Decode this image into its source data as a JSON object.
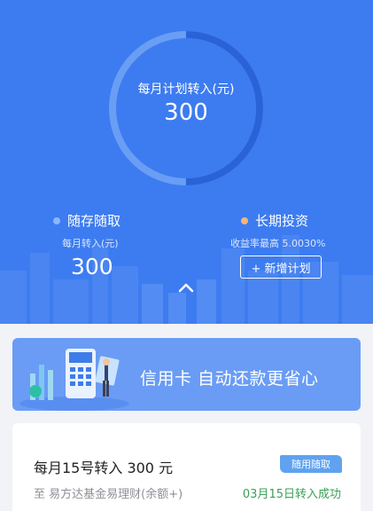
{
  "monthly_plan": {
    "label": "每月计划转入(元)",
    "value": "300",
    "progress": 0.5
  },
  "options": {
    "flexible": {
      "label": "随存随取",
      "sub_label": "每月转入(元)",
      "value": "300",
      "dot_color": "#8ab6ff"
    },
    "long_term": {
      "label": "长期投资",
      "sub_label": "收益率最高 5.0030%",
      "button_label": "+ 新增计划",
      "dot_color": "#f3b77a"
    }
  },
  "banner": {
    "text": "信用卡  自动还款更省心"
  },
  "plan": {
    "title": "每月15号转入 300 元",
    "badge": "随用随取",
    "target": "至 易方达基金易理财(余额+)",
    "status": "03月15日转入成功",
    "status_color": "#3aa055"
  },
  "colors": {
    "hero_bg": "#3d7cf0",
    "accent": "#2f6ee0"
  }
}
